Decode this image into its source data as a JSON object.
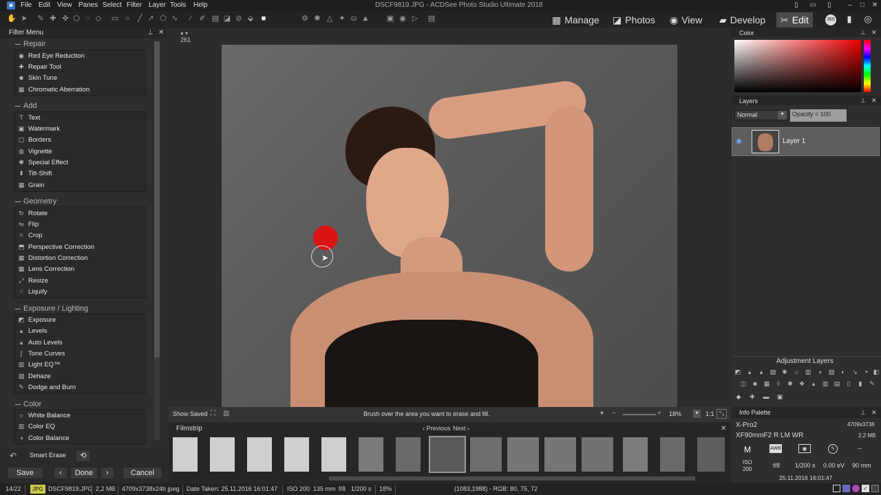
{
  "window": {
    "title": "DSCF9819.JPG - ACDSee Photo Studio Ultimate 2018"
  },
  "menu": [
    "File",
    "Edit",
    "View",
    "Panes",
    "Select",
    "Filter",
    "Layer",
    "Tools",
    "Help"
  ],
  "modes": [
    {
      "label": "Manage",
      "icon": "grid-icon"
    },
    {
      "label": "Photos",
      "icon": "photos-icon"
    },
    {
      "label": "View",
      "icon": "eye-icon"
    },
    {
      "label": "Develop",
      "icon": "develop-icon"
    },
    {
      "label": "Edit",
      "icon": "edit-icon",
      "active": true
    }
  ],
  "filter_menu": {
    "title": "Filter Menu",
    "groups": [
      {
        "name": "Repair",
        "items": [
          "Red Eye Reduction",
          "Repair Tool",
          "Skin Tune",
          "Chromatic Aberration"
        ]
      },
      {
        "name": "Add",
        "items": [
          "Text",
          "Watermark",
          "Borders",
          "Vignette",
          "Special Effect",
          "Tilt-Shift",
          "Grain"
        ]
      },
      {
        "name": "Geometry",
        "items": [
          "Rotate",
          "Flip",
          "Crop",
          "Perspective Correction",
          "Distortion Correction",
          "Lens Correction",
          "Resize",
          "Liquify"
        ]
      },
      {
        "name": "Exposure / Lighting",
        "items": [
          "Exposure",
          "Levels",
          "Auto Levels",
          "Tone Curves",
          "Light EQ™",
          "Dehaze",
          "Dodge and Burn"
        ]
      },
      {
        "name": "Color",
        "items": [
          "White Balance",
          "Color EQ",
          "Color Balance"
        ]
      }
    ]
  },
  "tool": {
    "name": "Smart Erase",
    "save": "Save",
    "done": "Done",
    "cancel": "Cancel"
  },
  "canvas": {
    "counter": "261",
    "show_saved": "Show Saved",
    "hint": "Brush over the area you want to erase and fill.",
    "zoom": "18%",
    "zoom_11": "1:1"
  },
  "filmstrip": {
    "title": "Filmstrip",
    "previous": "Previous",
    "next": "Next",
    "count": 15,
    "selected_index": 7
  },
  "color_panel": {
    "title": "Color"
  },
  "layers_panel": {
    "title": "Layers",
    "blend_mode": "Normal",
    "opacity": "Opacity = 100",
    "layer_name": "Layer 1"
  },
  "adjustment_layers": {
    "title": "Adjustment Layers"
  },
  "info_palette": {
    "title": "Info Palette",
    "camera": "X-Pro2",
    "dimensions": "4709x3738",
    "lens": "XF90mmF2 R LM WR",
    "size": "2,2 MB",
    "mode": "M",
    "awb": "AWB",
    "iso_label": "ISO",
    "iso": "200",
    "aperture": "f/8",
    "shutter": "1/200 s",
    "ev": "0.00 eV",
    "focal": "90 mm",
    "flash_val": "--",
    "date": "25.11.2016 16:01:47"
  },
  "status": {
    "index": "14/22",
    "format": "JPG",
    "filename": "DSCF9819.JPG",
    "filesize": "2,2 MB",
    "dims": "4709x3738x24b jpeg",
    "date": "Date Taken: 25.11.2016 16:01:47",
    "iso": "ISO 200",
    "focal": "135 mm",
    "aperture": "f/8",
    "shutter": "1/200 s",
    "zoom": "18%",
    "pixel": "(1083,1988) - RGB: 80, 75, 72"
  },
  "colors": {
    "accent_red": "#d81414",
    "panel": "#2e2e2e",
    "active_tab": "#4a4a4a"
  }
}
